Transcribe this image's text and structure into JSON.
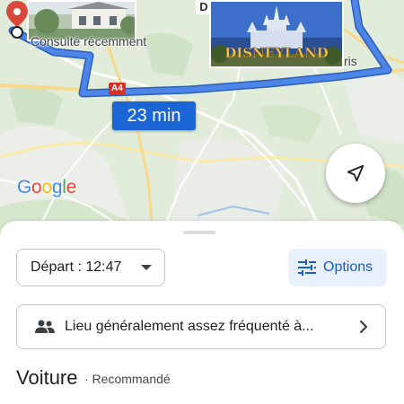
{
  "map": {
    "recent_label": "Consulté récemment",
    "place_suffix": "ris",
    "place_prefix_partial": "D",
    "road_badge": "A4",
    "duration": "23 min",
    "logo_text": "Google",
    "castle_sign": "DISNEYLAND"
  },
  "toolbar": {
    "depart_label": "Départ : 12:47",
    "options_label": "Options"
  },
  "crowd": {
    "label": "Lieu généralement assez fréquenté à..."
  },
  "mode": {
    "title": "Voiture",
    "subtitle": "· Recommandé"
  },
  "colors": {
    "route": "#4d86e8",
    "primary": "#1a66d6",
    "options_bg": "#e8f0fe",
    "badge_red": "#d93025",
    "pin_red": "#d9483b"
  },
  "icons": {
    "pin": "location-pin-icon",
    "locate": "navigation-arrow-icon",
    "options": "tune-sliders-icon",
    "people": "people-icon",
    "chevron": "chevron-right-icon",
    "caret": "caret-down-icon"
  }
}
